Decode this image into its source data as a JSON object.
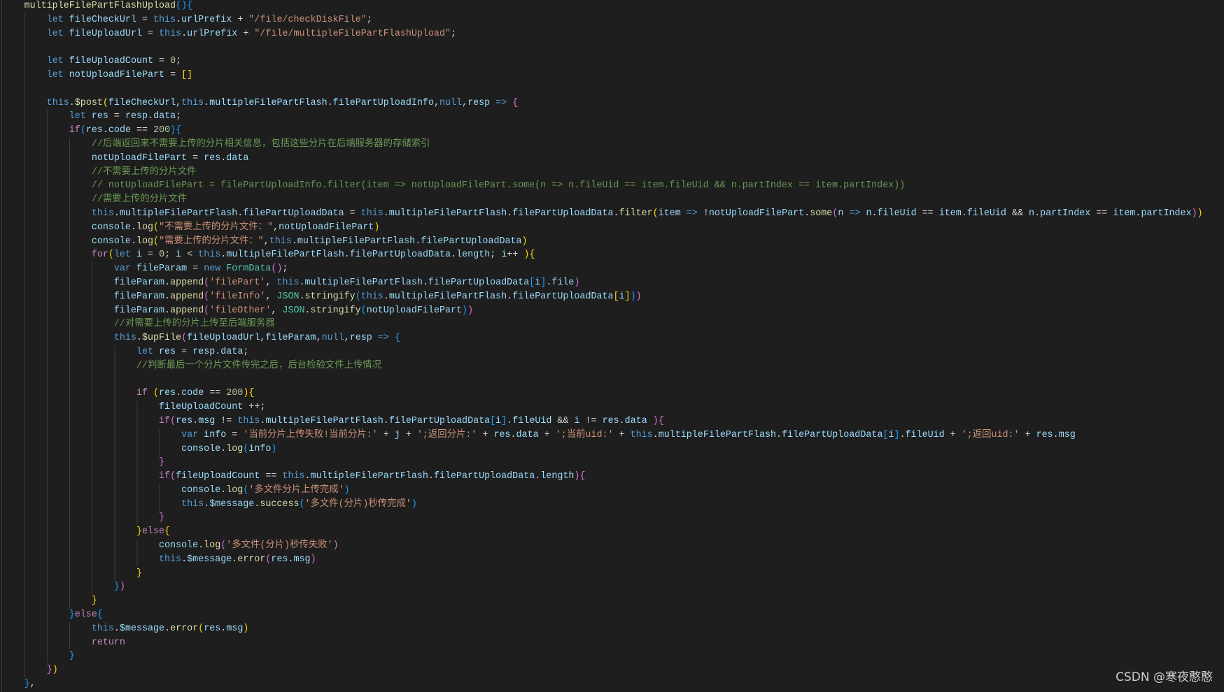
{
  "theme": {
    "background": "#1e1e1e",
    "plain": "#d4d4d4",
    "keyword": "#569cd6",
    "control": "#c586c0",
    "variable": "#9cdcfe",
    "function": "#dcdcaa",
    "type": "#4ec9b0",
    "string": "#ce9178",
    "number": "#b5cea8",
    "comment": "#6a9955",
    "brackets": [
      "#ffd700",
      "#da70d6",
      "#179fff"
    ],
    "indent_guide": "#3c3c3c"
  },
  "code": {
    "lines": [
      "multipleFilePartFlashUpload(){",
      "    let fileCheckUrl = this.urlPrefix + \"/file/checkDiskFile\";",
      "    let fileUploadUrl = this.urlPrefix + \"/file/multipleFilePartFlashUpload\";",
      "",
      "    let fileUploadCount = 0;",
      "    let notUploadFilePart = []",
      "",
      "    this.$post(fileCheckUrl,this.multipleFilePartFlash.filePartUploadInfo,null,resp => {",
      "        let res = resp.data;",
      "        if(res.code == 200){",
      "            //后端返回来不需要上传的分片相关信息，包括这些分片在后端服务器的存储索引",
      "            notUploadFilePart = res.data",
      "            //不需要上传的分片文件",
      "            // notUploadFilePart = filePartUploadInfo.filter(item => notUploadFilePart.some(n => n.fileUid == item.fileUid && n.partIndex == item.partIndex))",
      "            //需要上传的分片文件",
      "            this.multipleFilePartFlash.filePartUploadData = this.multipleFilePartFlash.filePartUploadData.filter(item => !notUploadFilePart.some(n => n.fileUid == item.fileUid && n.partIndex == item.partIndex))",
      "            console.log(\"不需要上传的分片文件：\",notUploadFilePart)",
      "            console.log(\"需要上传的分片文件：\",this.multipleFilePartFlash.filePartUploadData)",
      "            for(let i = 0; i < this.multipleFilePartFlash.filePartUploadData.length; i++ ){",
      "                var fileParam = new FormData();",
      "                fileParam.append('filePart', this.multipleFilePartFlash.filePartUploadData[i].file)",
      "                fileParam.append('fileInfo', JSON.stringify(this.multipleFilePartFlash.filePartUploadData[i]))",
      "                fileParam.append('fileOther', JSON.stringify(notUploadFilePart))",
      "                //对需要上传的分片上传至后端服务器",
      "                this.$upFile(fileUploadUrl,fileParam,null,resp => {",
      "                    let res = resp.data;",
      "                    //判断最后一个分片文件传完之后，后台检验文件上传情况",
      "",
      "                    if (res.code == 200){",
      "                        fileUploadCount ++;",
      "                        if(res.msg != this.multipleFilePartFlash.filePartUploadData[i].fileUid && i != res.data ){",
      "                            var info = '当前分片上传失败!当前分片:' + j + ';返回分片:' + res.data + ';当前uid:' + this.multipleFilePartFlash.filePartUploadData[i].fileUid + ';返回uid:' + res.msg",
      "                            console.log(info)",
      "                        }",
      "                        if(fileUploadCount == this.multipleFilePartFlash.filePartUploadData.length){",
      "                            console.log('多文件分片上传完成')",
      "                            this.$message.success('多文件(分片)秒传完成')",
      "                        }",
      "                    }else{",
      "                        console.log('多文件(分片)秒传失败')",
      "                        this.$message.error(res.msg)",
      "                    }",
      "                })",
      "            }",
      "        }else{",
      "            this.$message.error(res.msg)",
      "            return",
      "        }",
      "    })",
      "},"
    ]
  },
  "watermark": "CSDN @寒夜憨憨"
}
